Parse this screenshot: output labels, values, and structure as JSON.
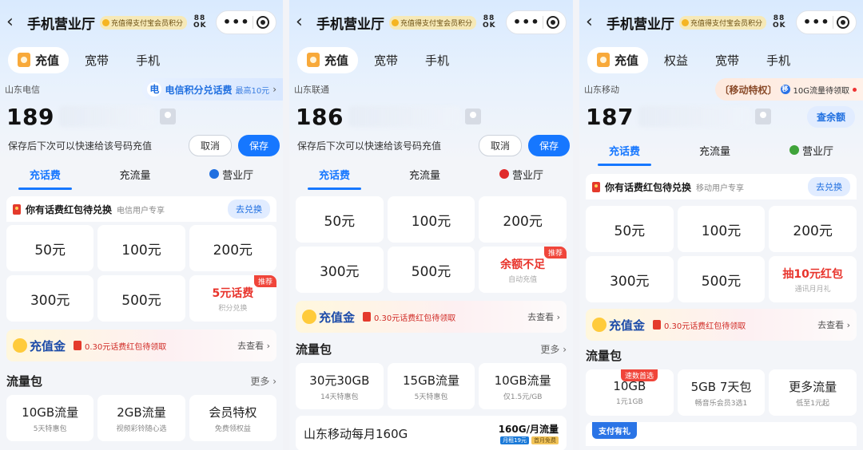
{
  "panels": [
    {
      "title": "手机营业厅",
      "badge": "充值得支付宝会员积分",
      "qr": "88\nOK",
      "top_tabs": [
        "充值",
        "宽带",
        "手机"
      ],
      "carrier": "山东电信",
      "promo": {
        "icon": "电",
        "main": "电信积分兑话费",
        "sub": "最高10元",
        "arrow": "›"
      },
      "number": "189",
      "save_hint": "保存后下次可以快速给该号码充值",
      "cancel": "取消",
      "save": "保存",
      "sub_tabs": [
        "充话费",
        "充流量",
        "营业厅"
      ],
      "redpacket": {
        "text": "你有话费红包待兑换",
        "sub": "电信用户专享",
        "btn": "去兑换"
      },
      "cells": [
        {
          "amt": "50元"
        },
        {
          "amt": "100元"
        },
        {
          "amt": "200元"
        },
        {
          "amt": "300元"
        },
        {
          "amt": "500元"
        },
        {
          "red": "5元话费",
          "sub": "积分兑换",
          "tag": "推荐"
        }
      ],
      "gold": {
        "title": "充值金",
        "text": "0.30元话费红包待领取",
        "link": "去查看 ›"
      },
      "pkg": {
        "title": "流量包",
        "more": "更多 ›",
        "items": [
          {
            "m": "10GB流量",
            "s": "5天特惠包"
          },
          {
            "m": "2GB流量",
            "s": "视频彩铃随心选"
          },
          {
            "m": "会员特权",
            "s": "免费领权益"
          }
        ]
      }
    },
    {
      "title": "手机营业厅",
      "badge": "充值得支付宝会员积分",
      "qr": "88\nOK",
      "top_tabs": [
        "充值",
        "宽带",
        "手机"
      ],
      "carrier": "山东联通",
      "number": "186",
      "save_hint": "保存后下次可以快速给该号码充值",
      "cancel": "取消",
      "save": "保存",
      "sub_tabs": [
        "充话费",
        "充流量",
        "营业厅"
      ],
      "cells": [
        {
          "amt": "50元"
        },
        {
          "amt": "100元"
        },
        {
          "amt": "200元"
        },
        {
          "amt": "300元"
        },
        {
          "amt": "500元"
        },
        {
          "red": "余额不足",
          "sub": "自动充值",
          "tag": "推荐"
        }
      ],
      "gold": {
        "title": "充值金",
        "text": "0.30元话费红包待领取",
        "link": "去查看 ›"
      },
      "pkg": {
        "title": "流量包",
        "more": "更多 ›",
        "items": [
          {
            "m": "30元30GB",
            "s": "14天特惠包"
          },
          {
            "m": "15GB流量",
            "s": "5天特惠包"
          },
          {
            "m": "10GB流量",
            "s": "仅1.5元/GB"
          }
        ]
      },
      "banner": {
        "title": "山东移动每月160G",
        "right": "160G/月流量",
        "chips": [
          "月租19元",
          "首月免费"
        ]
      }
    },
    {
      "title": "手机营业厅",
      "badge": "充值得支付宝会员积分",
      "qr": "88\nOK",
      "top_tabs": [
        "充值",
        "权益",
        "宽带",
        "手机"
      ],
      "carrier": "山东移动",
      "promo": {
        "icon": "移",
        "main": "〔移动特权〕",
        "sub": "10G流量待领取"
      },
      "number": "187",
      "check_balance": "查余额",
      "sub_tabs": [
        "充话费",
        "充流量",
        "营业厅"
      ],
      "redpacket": {
        "text": "你有话费红包待兑换",
        "sub": "移动用户专享",
        "btn": "去兑换"
      },
      "cells": [
        {
          "amt": "50元"
        },
        {
          "amt": "100元"
        },
        {
          "amt": "200元"
        },
        {
          "amt": "300元"
        },
        {
          "amt": "500元"
        },
        {
          "red": "抽10元红包",
          "sub": "通讯月月礼"
        }
      ],
      "gold": {
        "title": "充值金",
        "text": "0.30元话费红包待领取",
        "link": "去查看 ›"
      },
      "pkg": {
        "title": "流量包",
        "items": [
          {
            "m": "10GB",
            "s": "1元1GB",
            "tag": "速数首选"
          },
          {
            "m": "5GB 7天包",
            "s": "畅音乐会员3选1"
          },
          {
            "m": "更多流量",
            "s": "低至1元起"
          }
        ]
      },
      "pay_gift": "支付有礼"
    }
  ]
}
